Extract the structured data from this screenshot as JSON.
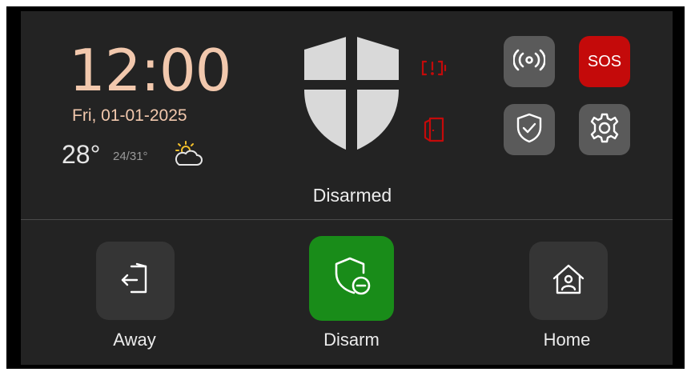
{
  "clock": {
    "time": "12:00",
    "date": "Fri, 01-01-2025"
  },
  "weather": {
    "temperature": "28°",
    "range": "24/31°",
    "icon": "partly-sunny-icon"
  },
  "status": {
    "label": "Disarmed",
    "icon": "shield-icon"
  },
  "indicators": {
    "alert_icon": "tamper-alert-icon",
    "door_icon": "door-icon",
    "color": "#c40a0a"
  },
  "quick_actions": {
    "wireless_icon": "wireless-signal-icon",
    "sos_label": "SOS",
    "protect_icon": "shield-check-icon",
    "settings_icon": "gear-icon"
  },
  "modes": [
    {
      "label": "Away",
      "icon": "exit-door-icon"
    },
    {
      "label": "Disarm",
      "icon": "shield-minus-icon",
      "active": true
    },
    {
      "label": "Home",
      "icon": "home-person-icon"
    }
  ],
  "colors": {
    "accent_text": "#f2c8ad",
    "active_mode": "#198c19",
    "sos": "#c40a0a",
    "background": "#232323"
  }
}
